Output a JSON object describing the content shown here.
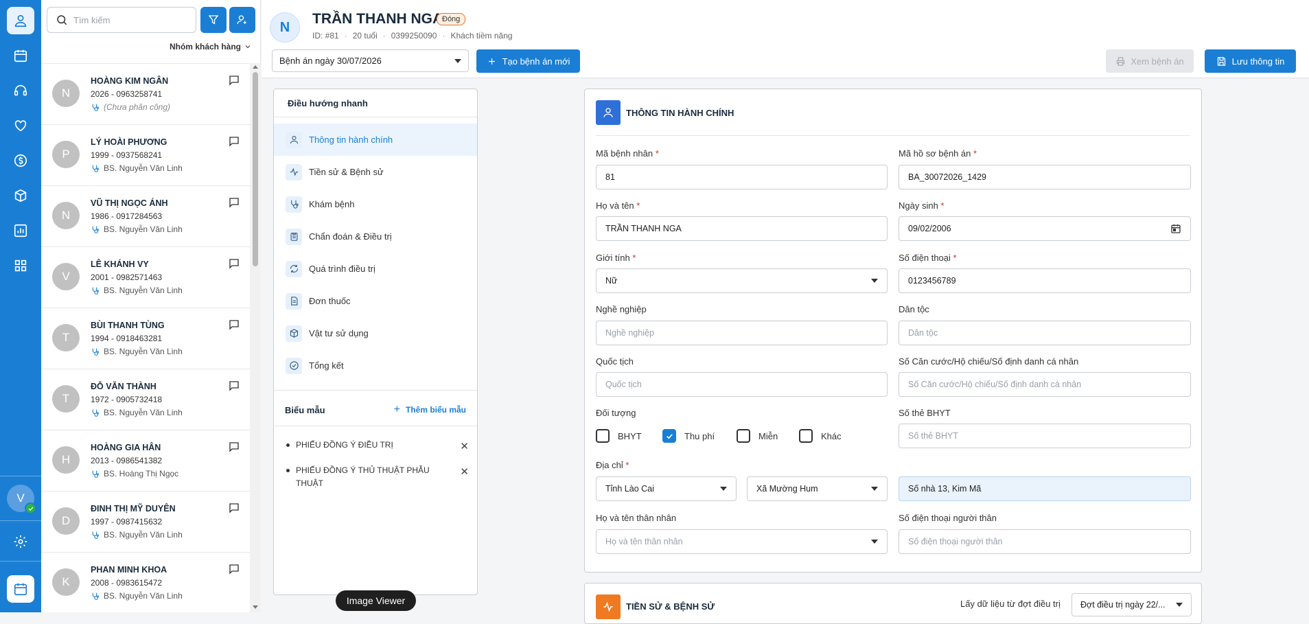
{
  "search": {
    "placeholder": "Tìm kiếm"
  },
  "group_filter": {
    "label": "Nhóm khách hàng"
  },
  "patients": [
    {
      "initial": "N",
      "name": "HOÀNG KIM NGÂN",
      "sub": "2026 - 0963258741",
      "doctor": "(Chưa phân công)"
    },
    {
      "initial": "P",
      "name": "LÝ HOÀI PHƯƠNG",
      "sub": "1999 - 0937568241",
      "doctor": "BS. Nguyễn Văn Linh"
    },
    {
      "initial": "N",
      "name": "VŨ THỊ NGỌC ÁNH",
      "sub": "1986 - 0917284563",
      "doctor": "BS. Nguyễn Văn Linh"
    },
    {
      "initial": "V",
      "name": "LÊ KHÁNH VY",
      "sub": "2001 - 0982571463",
      "doctor": "BS. Nguyễn Văn Linh"
    },
    {
      "initial": "T",
      "name": "BÙI THANH TÙNG",
      "sub": "1994 - 0918463281",
      "doctor": "BS. Nguyễn Văn Linh"
    },
    {
      "initial": "T",
      "name": "ĐỖ VĂN THÀNH",
      "sub": "1972 - 0905732418",
      "doctor": "BS. Nguyễn Văn Linh"
    },
    {
      "initial": "H",
      "name": "HOÀNG GIA HÂN",
      "sub": "2013 - 0986541382",
      "doctor": "BS. Hoàng Thị Ngọc"
    },
    {
      "initial": "D",
      "name": "ĐINH THỊ MỸ DUYÊN",
      "sub": "1997 - 0987415632",
      "doctor": "BS. Nguyễn Văn Linh"
    },
    {
      "initial": "K",
      "name": "PHAN MINH KHOA",
      "sub": "2008 - 0983615472",
      "doctor": "BS. Nguyễn Văn Linh"
    }
  ],
  "user_avatar": {
    "initial": "V"
  },
  "header": {
    "initial": "N",
    "name": "TRẦN THANH NGA",
    "status": "Đóng",
    "id": "ID: #81",
    "age": "20 tuổi",
    "phone": "0399250090",
    "type": "Khách tiềm năng",
    "record_select": "Bệnh án ngày 30/07/2026",
    "create_label": "Tạo bệnh án mới",
    "view_label": "Xem bệnh án",
    "save_label": "Lưu thông tin"
  },
  "nav": {
    "title": "Điều hướng nhanh",
    "items": [
      {
        "label": "Thông tin hành chính",
        "icon": "user-icon"
      },
      {
        "label": "Tiền sử & Bệnh sử",
        "icon": "activity-icon"
      },
      {
        "label": "Khám bệnh",
        "icon": "stethoscope-icon"
      },
      {
        "label": "Chẩn đoán & Điều trị",
        "icon": "clipboard-icon"
      },
      {
        "label": "Quá trình điều trị",
        "icon": "refresh-icon"
      },
      {
        "label": "Đơn thuốc",
        "icon": "document-icon"
      },
      {
        "label": "Vật tư sử dụng",
        "icon": "box-icon"
      },
      {
        "label": "Tổng kết",
        "icon": "check-circle-icon"
      }
    ],
    "forms_title": "Biểu mẫu",
    "forms_add": "Thêm biểu mẫu",
    "forms": [
      "PHIẾU ĐỒNG Ý ĐIỀU TRỊ",
      "PHIẾU ĐỒNG Ý THỦ THUẬT PHẪU THUẬT"
    ]
  },
  "viewer_label": "Image Viewer",
  "admin": {
    "title": "THÔNG TIN HÀNH CHÍNH",
    "patient_code_label": "Mã bệnh nhân",
    "patient_code": "81",
    "record_code_label": "Mã hồ sơ bệnh án",
    "record_code": "BA_30072026_1429",
    "fullname_label": "Họ và tên",
    "fullname": "TRẦN THANH NGA",
    "dob_label": "Ngày sinh",
    "dob": "09/02/2006",
    "gender_label": "Giới tính",
    "gender": "Nữ",
    "phone_label": "Số điện thoại",
    "phone": "0123456789",
    "job_label": "Nghề nghiệp",
    "job_placeholder": "Nghề nghiệp",
    "ethnic_label": "Dân tộc",
    "ethnic_placeholder": "Dân tộc",
    "nationality_label": "Quốc tịch",
    "nationality_placeholder": "Quốc tịch",
    "idcard_label": "Số Căn cước/Hộ chiếu/Số định danh cá nhân",
    "idcard_placeholder": "Số Căn cước/Hộ chiếu/Số định danh cá nhân",
    "subject_label": "Đối tượng",
    "subjects": [
      {
        "label": "BHYT",
        "checked": false
      },
      {
        "label": "Thu phí",
        "checked": true
      },
      {
        "label": "Miễn",
        "checked": false
      },
      {
        "label": "Khác",
        "checked": false
      }
    ],
    "insurance_label": "Số thẻ BHYT",
    "insurance_placeholder": "Số thẻ BHYT",
    "address_label": "Địa chỉ",
    "province": "Tỉnh Lào Cai",
    "commune": "Xã Mường Hum",
    "street": "Số nhà 13, Kim Mã",
    "relative_label": "Họ và tên thân nhân",
    "relative_placeholder": "Họ và tên thân nhân",
    "relative_phone_label": "Số điện thoại người thân",
    "relative_phone_placeholder": "Số điện thoại người thân"
  },
  "history": {
    "title": "TIỀN SỬ & BỆNH SỬ",
    "source_label": "Lấy dữ liệu từ đợt điều trị",
    "source_value": "Đợt điều trị ngày 22/..."
  }
}
